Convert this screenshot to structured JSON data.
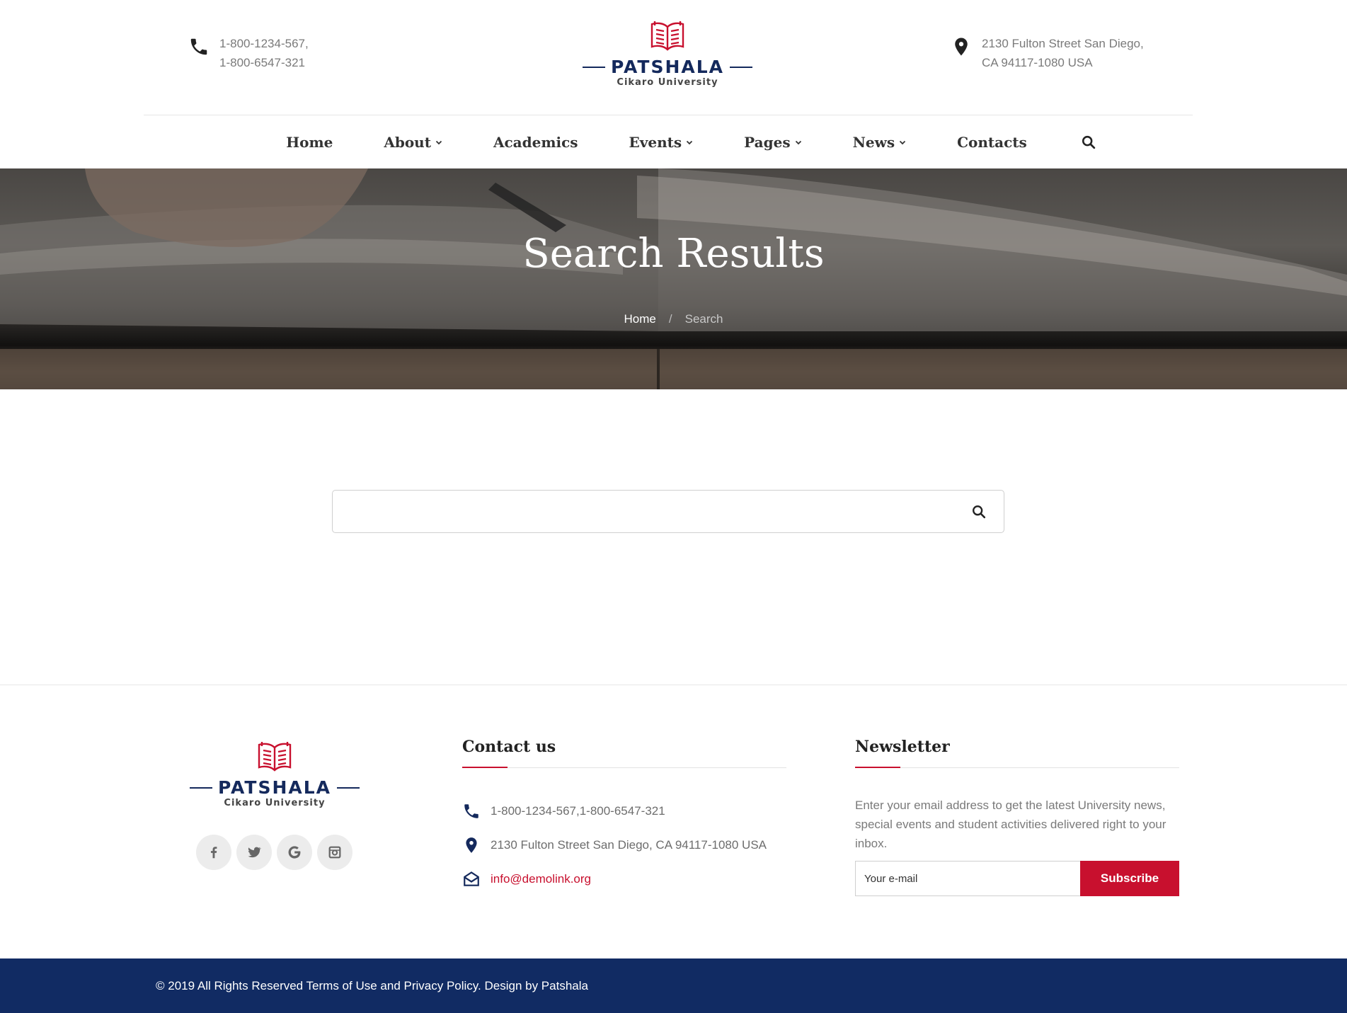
{
  "header": {
    "phone_lines": [
      "1-800-1234-567,",
      "1-800-6547-321"
    ],
    "address_lines": [
      "2130 Fulton Street San Diego,",
      "CA 94117-1080 USA"
    ],
    "logo": {
      "brand": "PATSHALA",
      "subtitle": "Cikaro University"
    }
  },
  "nav": {
    "items": [
      {
        "label": "Home",
        "has_dropdown": false
      },
      {
        "label": "About",
        "has_dropdown": true
      },
      {
        "label": "Academics",
        "has_dropdown": false
      },
      {
        "label": "Events",
        "has_dropdown": true
      },
      {
        "label": "Pages",
        "has_dropdown": true
      },
      {
        "label": "News",
        "has_dropdown": true
      },
      {
        "label": "Contacts",
        "has_dropdown": false
      }
    ],
    "search_icon": "search-icon"
  },
  "hero": {
    "title": "Search Results",
    "breadcrumb": {
      "home": "Home",
      "separator": "/",
      "current": "Search"
    }
  },
  "search": {
    "value": "",
    "icon": "search-icon"
  },
  "footer": {
    "logo": {
      "brand": "PATSHALA",
      "subtitle": "Cikaro University"
    },
    "socials": [
      "facebook-icon",
      "twitter-icon",
      "google-icon",
      "instagram-icon"
    ],
    "contact": {
      "title": "Contact us",
      "phone": "1-800-1234-567,1-800-6547-321",
      "address": "2130 Fulton Street San Diego, CA 94117-1080 USA",
      "email": "info@demolink.org"
    },
    "newsletter": {
      "title": "Newsletter",
      "text": "Enter your email address to get the latest University news, special events and student activities delivered right to your inbox.",
      "placeholder": "Your e-mail",
      "button": "Subscribe"
    },
    "copyright": "© 2019 All Rights Reserved Terms of Use and Privacy Policy. Design by Patshala"
  },
  "colors": {
    "brand_navy": "#14295c",
    "accent_red": "#c8102e",
    "bottom_bar": "#112b63"
  }
}
